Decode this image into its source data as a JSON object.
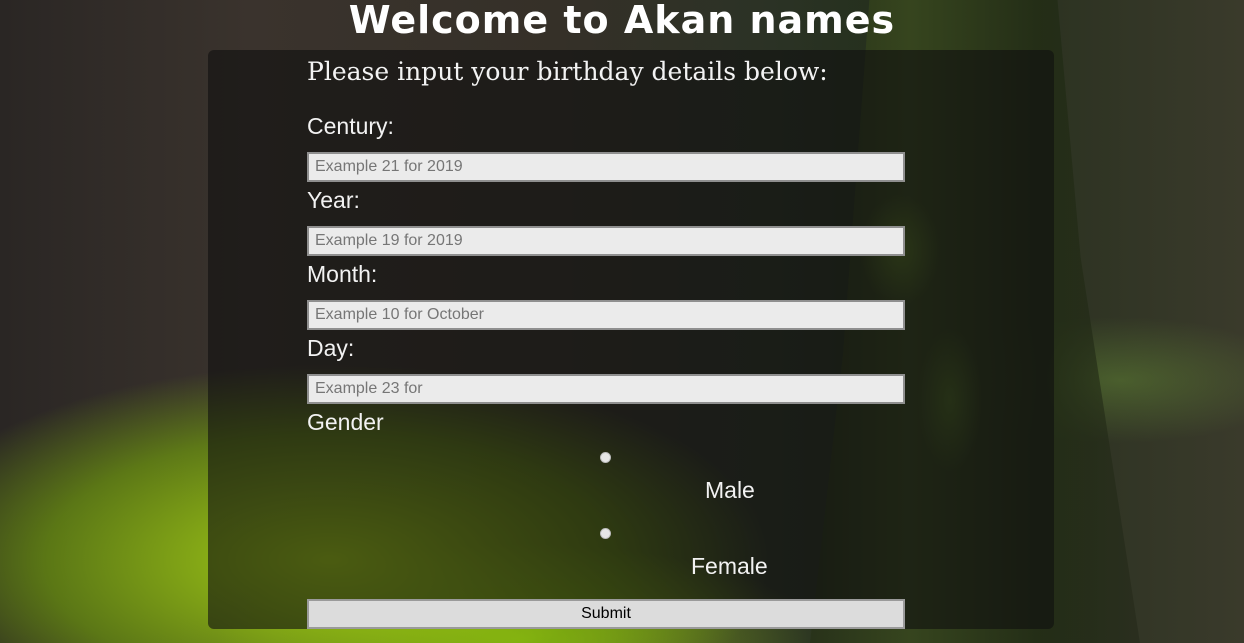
{
  "header": {
    "title": "Welcome to Akan names"
  },
  "form": {
    "subtitle": "Please input your birthday details below:",
    "century": {
      "label": "Century:",
      "placeholder": "Example 21 for 2019",
      "value": ""
    },
    "year": {
      "label": "Year:",
      "placeholder": "Example 19 for 2019",
      "value": ""
    },
    "month": {
      "label": "Month:",
      "placeholder": "Example 10 for October",
      "value": ""
    },
    "day": {
      "label": "Day:",
      "placeholder": "Example 23 for",
      "value": ""
    },
    "gender": {
      "label": "Gender",
      "options": [
        {
          "label": "Male",
          "selected": false
        },
        {
          "label": "Female",
          "selected": false
        }
      ]
    },
    "submit_label": "Submit"
  },
  "colors": {
    "panel_overlay": "#0f0f0f",
    "input_background": "#ebebeb",
    "text": "#f2f2f2"
  }
}
